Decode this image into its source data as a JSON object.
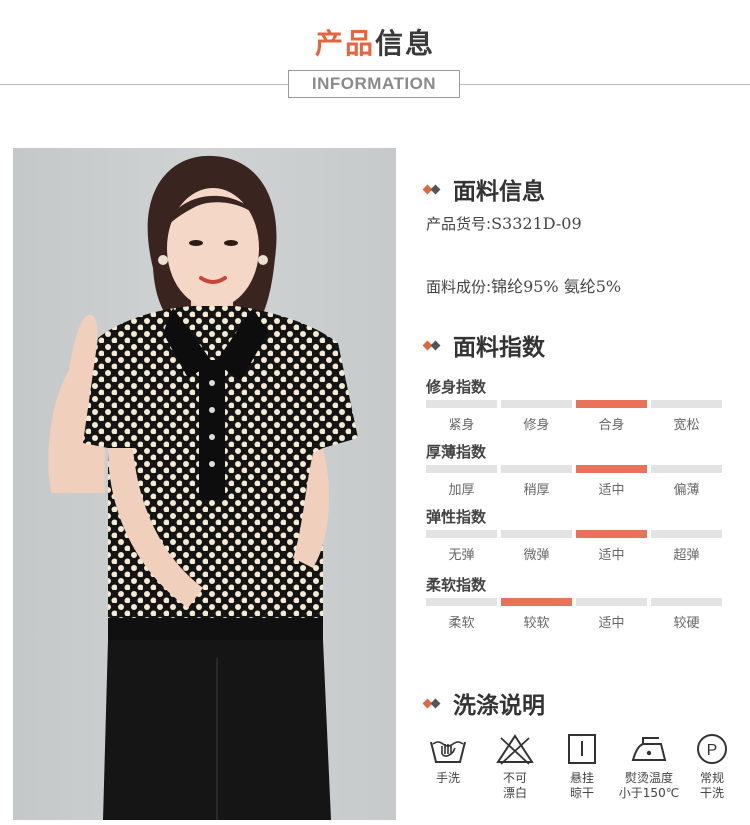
{
  "header": {
    "title_accent": "产品",
    "title_rest": "信息",
    "subtitle": "INFORMATION"
  },
  "fabric_info": {
    "title": "面料信息",
    "item_no_label": "产品货号:",
    "item_no_value": "S3321D-09",
    "composition_label": "面料成份:",
    "composition_value": "锦纶95% 氨纶5%"
  },
  "fabric_index": {
    "title": "面料指数",
    "accent_color": "#e8735a",
    "inactive_color": "#e3e3e3",
    "rows": [
      {
        "label": "修身指数",
        "options": [
          "紧身",
          "修身",
          "合身",
          "宽松"
        ],
        "selected_index": 2
      },
      {
        "label": "厚薄指数",
        "options": [
          "加厚",
          "稍厚",
          "适中",
          "偏薄"
        ],
        "selected_index": 2
      },
      {
        "label": "弹性指数",
        "options": [
          "无弹",
          "微弹",
          "适中",
          "超弹"
        ],
        "selected_index": 2
      },
      {
        "label": "柔软指数",
        "options": [
          "柔软",
          "较软",
          "适中",
          "较硬"
        ],
        "selected_index": 1
      }
    ]
  },
  "washing": {
    "title": "洗涤说明",
    "items": [
      {
        "icon": "hand-wash-icon",
        "label": "手洗"
      },
      {
        "icon": "no-bleach-icon",
        "label": "不可\n漂白"
      },
      {
        "icon": "hang-dry-icon",
        "label": "悬挂\n晾干"
      },
      {
        "icon": "iron-icon",
        "label": "熨烫温度\n小于150℃"
      },
      {
        "icon": "dry-clean-icon",
        "label": "常规\n干洗"
      }
    ]
  },
  "product_photo": {
    "icon": "model-photo"
  }
}
